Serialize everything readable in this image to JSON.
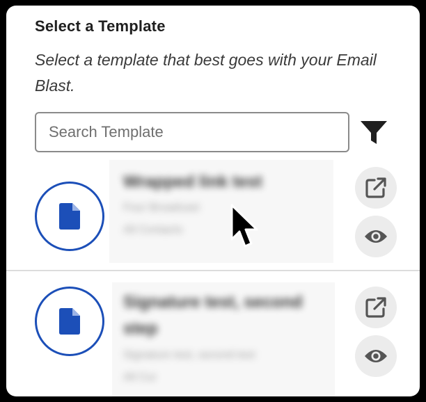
{
  "header": {
    "title": "Select a Template",
    "subtitle": "Select a template that best goes with your Email Blast."
  },
  "search": {
    "placeholder": "Search Template",
    "value": ""
  },
  "toolbar": {
    "filter_icon": "filter-icon"
  },
  "templates": [
    {
      "title": "Wrapped link test",
      "line1": "Four Broadcast",
      "line2": "All Contacts",
      "edit_icon": "external-edit-icon",
      "preview_icon": "eye-icon"
    },
    {
      "title": "Signature test, second step",
      "line1": "Signature test, second test",
      "line2": "All Cur",
      "edit_icon": "external-edit-icon",
      "preview_icon": "eye-icon"
    }
  ],
  "colors": {
    "accent": "#1c4fb8",
    "icon_button_bg": "#ececec",
    "text_primary": "#1f1f1f"
  }
}
